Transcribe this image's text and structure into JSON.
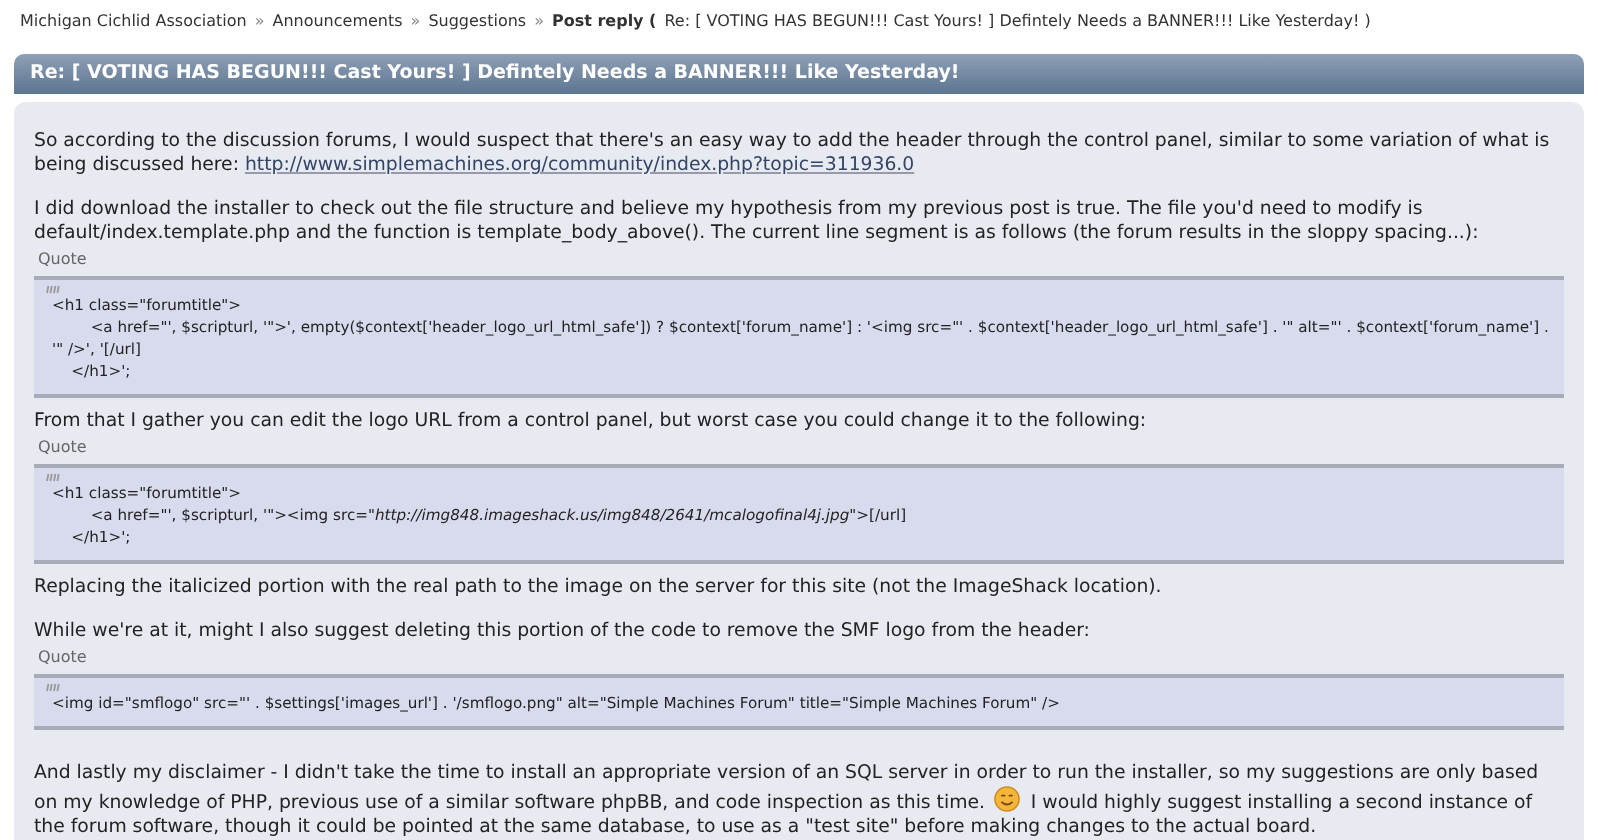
{
  "breadcrumb": {
    "items": [
      {
        "label": "Michigan Cichlid Association",
        "separator": "»"
      },
      {
        "label": "Announcements",
        "separator": "»"
      },
      {
        "label": "Suggestions",
        "separator": "»"
      }
    ],
    "current": "Post reply (",
    "suffix": "Re: [ VOTING HAS BEGUN!!! Cast Yours! ] Defintely Needs a BANNER!!! Like Yesterday! )"
  },
  "post": {
    "title": "Re: [ VOTING HAS BEGUN!!! Cast Yours! ] Defintely Needs a BANNER!!! Like Yesterday!",
    "blocks": [
      {
        "kind": "paragraph",
        "segments": [
          {
            "kind": "text",
            "text": "So according to the discussion forums, I would suspect that there's an easy way to add the header through the control panel, similar to some variation of what is being discussed here: "
          },
          {
            "kind": "link",
            "text": "http://www.simplemachines.org/community/index.php?topic=311936.0"
          }
        ]
      },
      {
        "kind": "paragraph",
        "segments": [
          {
            "kind": "text",
            "text": "I did download the installer to check out the file structure and believe my hypothesis from my previous post is true. The file you'd need to modify is default/index.template.php and the function is template_body_above(). The current line segment is as follows (the forum results in the sloppy spacing...):"
          }
        ]
      },
      {
        "kind": "quote",
        "label": "Quote",
        "code": "<h1 class=\"forumtitle\">\n\t\t<a href=\"', $scripturl, '\">', empty($context['header_logo_url_html_safe']) ? $context['forum_name'] : '<img src=\"' . $context['header_logo_url_html_safe'] . '\" alt=\"' . $context['forum_name'] . '\" />', '[/url]\n\t</h1>';"
      },
      {
        "kind": "paragraph",
        "segments": [
          {
            "kind": "text",
            "text": "From that I gather you can edit the logo URL from a control panel, but worst case you could change it to the following:"
          }
        ]
      },
      {
        "kind": "quote",
        "label": "Quote",
        "code": "<h1 class=\"forumtitle\">\n\t\t<a href=\"', $scripturl, '\"><img src=\"*http://img848.imageshack.us/img848/2641/mcalogofinal4j.jpg*\">[/url]\n\t</h1>';"
      },
      {
        "kind": "paragraph",
        "segments": [
          {
            "kind": "text",
            "text": "Replacing the italicized portion with the real path to the image on the server for this site (not the ImageShack location)."
          }
        ]
      },
      {
        "kind": "paragraph",
        "segments": [
          {
            "kind": "text",
            "text": "While we're at it, might I also suggest deleting this portion of the code to remove the SMF logo from the header:"
          }
        ]
      },
      {
        "kind": "quote",
        "label": "Quote",
        "code": "<img id=\"smflogo\" src=\"' . $settings['images_url'] . '/smflogo.png\" alt=\"Simple Machines Forum\" title=\"Simple Machines Forum\" />"
      },
      {
        "kind": "paragraph",
        "segments": [
          {
            "kind": "text",
            "text": "And lastly my disclaimer - I didn't take the time to install an appropriate version of an SQL server in order to run the installer, so my suggestions are only based on my knowledge of PHP, previous use of a similar software phpBB, and code inspection as this time. "
          },
          {
            "kind": "smiley"
          },
          {
            "kind": "text",
            "text": " I would highly suggest installing a second instance of the forum software, though it could be pointed at the same database, to use as a \"test site\" before making changes to the actual board."
          }
        ]
      }
    ]
  }
}
